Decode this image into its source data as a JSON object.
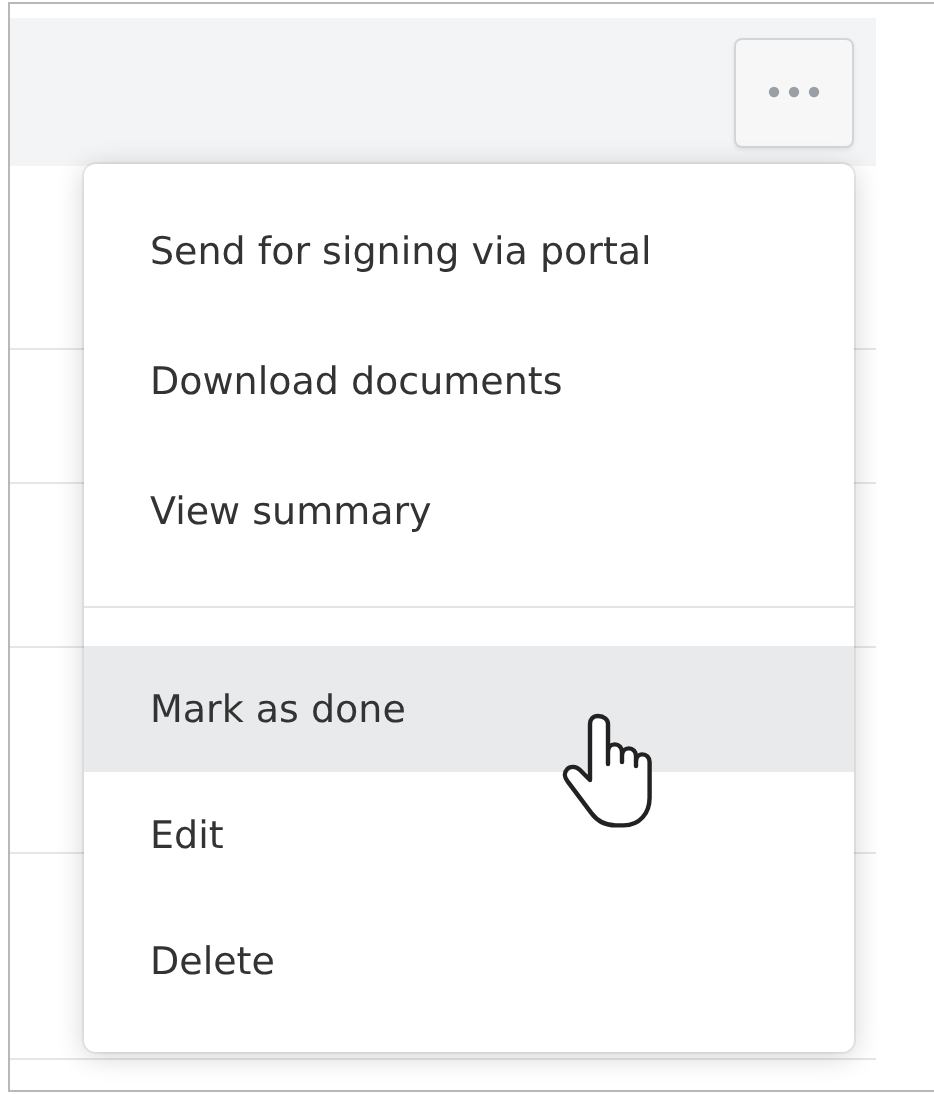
{
  "menu": {
    "groups": [
      {
        "items": [
          {
            "label": "Send for signing via portal",
            "selected": false
          },
          {
            "label": "Download documents",
            "selected": false
          },
          {
            "label": "View summary",
            "selected": false
          }
        ]
      },
      {
        "items": [
          {
            "label": "Mark as done",
            "selected": true
          },
          {
            "label": "Edit",
            "selected": false
          },
          {
            "label": "Delete",
            "selected": false
          }
        ]
      }
    ]
  }
}
